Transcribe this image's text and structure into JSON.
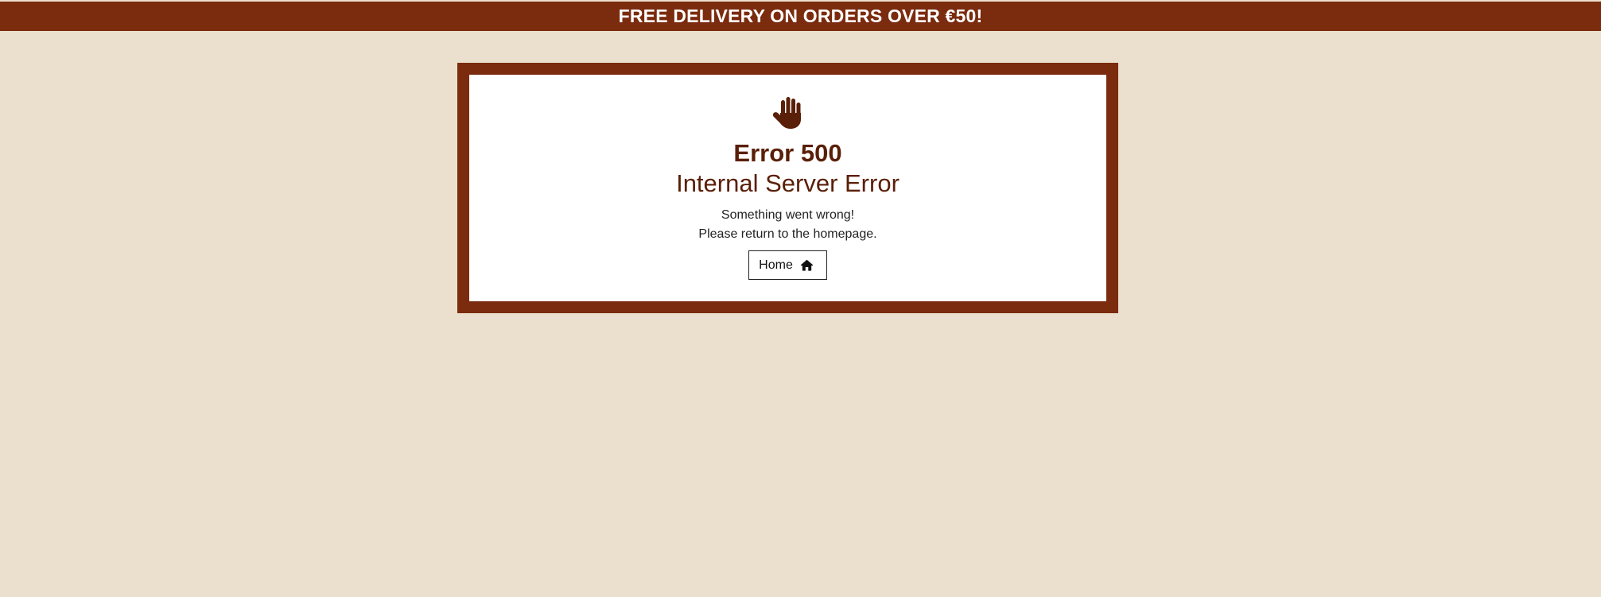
{
  "banner": {
    "text": "FREE DELIVERY ON ORDERS OVER €50!"
  },
  "error": {
    "icon": "hand-stop-icon",
    "code": "Error 500",
    "title": "Internal Server Error",
    "message_line1": "Something went wrong!",
    "message_line2": "Please return to the homepage.",
    "home_button_label": "Home",
    "home_button_icon": "home-icon"
  },
  "colors": {
    "brand": "#7b2b0e",
    "heading": "#5a1f08",
    "background": "#ebe0cd"
  }
}
